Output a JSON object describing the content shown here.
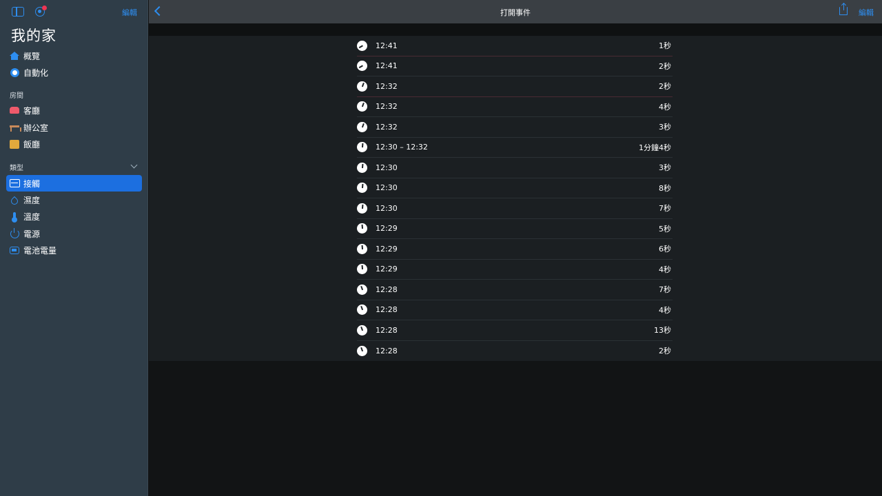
{
  "sidebar": {
    "edit_label": "編輯",
    "home_title": "我的家",
    "nav": [
      {
        "label": "概覽",
        "icon": "home-icon"
      },
      {
        "label": "自動化",
        "icon": "automation-icon"
      }
    ],
    "rooms_heading": "房間",
    "rooms": [
      {
        "label": "客廳",
        "icon": "sofa-icon"
      },
      {
        "label": "辦公室",
        "icon": "desk-icon"
      },
      {
        "label": "飯廳",
        "icon": "dining-icon"
      }
    ],
    "types_heading": "類型",
    "types": [
      {
        "label": "接觸",
        "icon": "contact-sensor-icon",
        "active": true
      },
      {
        "label": "濕度",
        "icon": "humidity-icon"
      },
      {
        "label": "溫度",
        "icon": "thermometer-icon"
      },
      {
        "label": "電源",
        "icon": "power-icon"
      },
      {
        "label": "電池電量",
        "icon": "battery-icon"
      }
    ]
  },
  "navbar": {
    "title": "打開事件",
    "edit_label": "編輯"
  },
  "events": [
    {
      "time": "12:41",
      "duration": "1秒"
    },
    {
      "time": "12:41",
      "duration": "2秒"
    },
    {
      "time": "12:32",
      "duration": "2秒"
    },
    {
      "time": "12:32",
      "duration": "4秒"
    },
    {
      "time": "12:32",
      "duration": "3秒"
    },
    {
      "time": "12:30 – 12:32",
      "duration": "1分鐘4秒"
    },
    {
      "time": "12:30",
      "duration": "3秒"
    },
    {
      "time": "12:30",
      "duration": "8秒"
    },
    {
      "time": "12:30",
      "duration": "7秒"
    },
    {
      "time": "12:29",
      "duration": "5秒"
    },
    {
      "time": "12:29",
      "duration": "6秒"
    },
    {
      "time": "12:29",
      "duration": "4秒"
    },
    {
      "time": "12:28",
      "duration": "7秒"
    },
    {
      "time": "12:28",
      "duration": "4秒"
    },
    {
      "time": "12:28",
      "duration": "13秒"
    },
    {
      "time": "12:28",
      "duration": "2秒"
    }
  ],
  "colors": {
    "accent": "#2e8ef0",
    "sidebar_bg": "#2f3d48",
    "active_item": "#1c6fe0",
    "notification_dot": "#ee3553"
  }
}
